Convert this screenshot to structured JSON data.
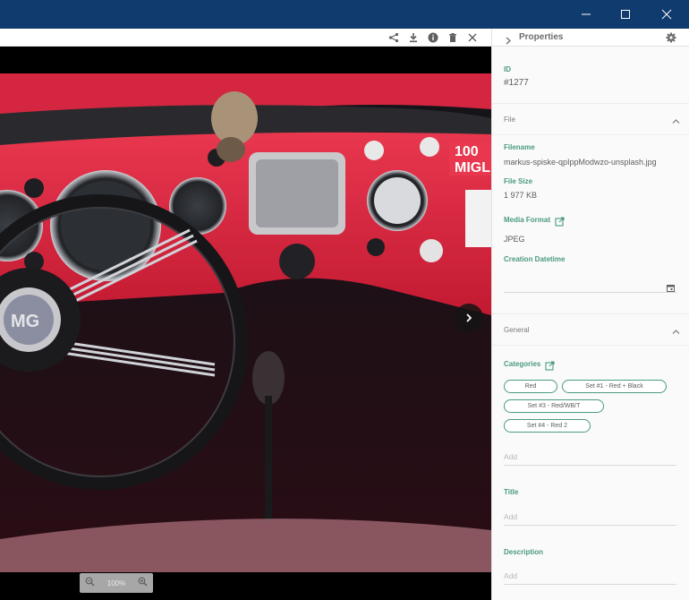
{
  "window": {
    "controls": [
      "minimize-icon",
      "maximize-icon",
      "close-icon"
    ]
  },
  "viewer": {
    "toolbar_icons": [
      "share-icon",
      "download-icon",
      "info-icon",
      "delete-icon",
      "close-icon"
    ],
    "zoom_level": "100%",
    "photo_description_icon": "car-dashboard-photo"
  },
  "panel": {
    "title": "Properties",
    "id_label": "ID",
    "id_value": "#1277",
    "file_section": "File",
    "filename_label": "Filename",
    "filename_value": "markus-spiske-qpIppModwzo-unsplash.jpg",
    "filesize_label": "File Size",
    "filesize_value": "1 977 KB",
    "mediaformat_label": "Media Format",
    "mediaformat_value": "JPEG",
    "creation_label": "Creation Datetime",
    "general_section": "General",
    "categories_label": "Categories",
    "categories": [
      "Red",
      "Set #1 - Red + Black",
      "Set #3 - Red/WB/T",
      "Set #4 - Red 2"
    ],
    "categories_placeholder": "Add",
    "title_label": "Title",
    "title_placeholder": "Add",
    "description_label": "Description",
    "description_placeholder": "Add"
  },
  "colors": {
    "titlebar": "#0f3b6e",
    "accent": "#4a9a82",
    "dashboard_red": "#e01e3c"
  }
}
